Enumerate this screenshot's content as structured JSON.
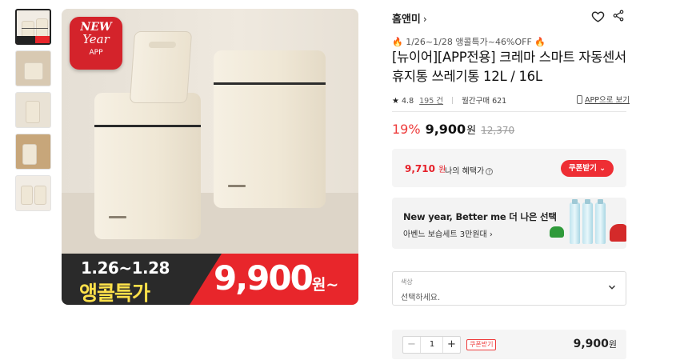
{
  "gallery": {
    "thumbnails": [
      {
        "name": "thumb-1",
        "active": true
      },
      {
        "name": "thumb-2",
        "active": false
      },
      {
        "name": "thumb-3",
        "active": false
      },
      {
        "name": "thumb-4",
        "active": false
      },
      {
        "name": "thumb-5",
        "active": false
      }
    ],
    "hero": {
      "badge_line1": "NEW",
      "badge_line2": "Year",
      "badge_line3": "APP",
      "promo_dates": "1.26~1.28",
      "promo_event": "앵콜특가",
      "promo_price": "9,900",
      "promo_price_unit": "원~"
    }
  },
  "shop": {
    "name": "홈앤미",
    "chevron": "›"
  },
  "product": {
    "promo_fire_left": "🔥",
    "promo_text": " 1/26~1/28 앵콜특가~46%OFF ",
    "promo_fire_right": "🔥",
    "title": "[뉴이어][APP전용] 크레마 스마트 자동센서 휴지통 쓰레기통 12L / 16L",
    "rating": "4.8",
    "review_count": "195 건",
    "monthly_sales": "월간구매 621",
    "app_view_label": "APP으로 보기",
    "discount_rate": "19%",
    "price": "9,900",
    "price_unit": "원",
    "original_price": "12,370"
  },
  "coupon": {
    "coupon_price": "9,710",
    "coupon_unit": "원",
    "benefit_label": "나의 혜택가",
    "help": "?",
    "button_label": "쿠폰받기"
  },
  "banner": {
    "title": "New year, Better me 더 나은 선택",
    "subtitle": "아벤느 보습세트 3만원대 ›"
  },
  "option": {
    "label": "색상",
    "placeholder": "선택하세요."
  },
  "quantity": {
    "minus": "−",
    "value": "1",
    "plus": "+",
    "coupon_tag": "쿠폰받기",
    "total_price": "9,900",
    "total_unit": "원"
  },
  "colors": {
    "accent_red": "#ee2e34",
    "discount_red": "#ee3b3b",
    "promo_yellow": "#ffe14a"
  }
}
